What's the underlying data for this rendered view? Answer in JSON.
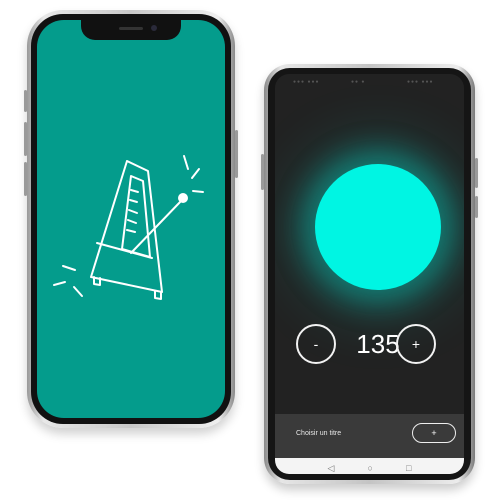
{
  "colors": {
    "teal_background": "#049c8c",
    "tempo_circle": "#00f5e3",
    "app_background": "#222222",
    "panel_background": "#3a3a3a"
  },
  "splash": {
    "logo_icon": "metronome-icon"
  },
  "metronome": {
    "tempo": "135",
    "decrease_label": "-",
    "increase_label": "+",
    "title_placeholder": "Choisir un titre",
    "add_label": "+"
  },
  "nav": {
    "back_icon": "◁",
    "home_icon": "○",
    "recents_icon": "□"
  }
}
